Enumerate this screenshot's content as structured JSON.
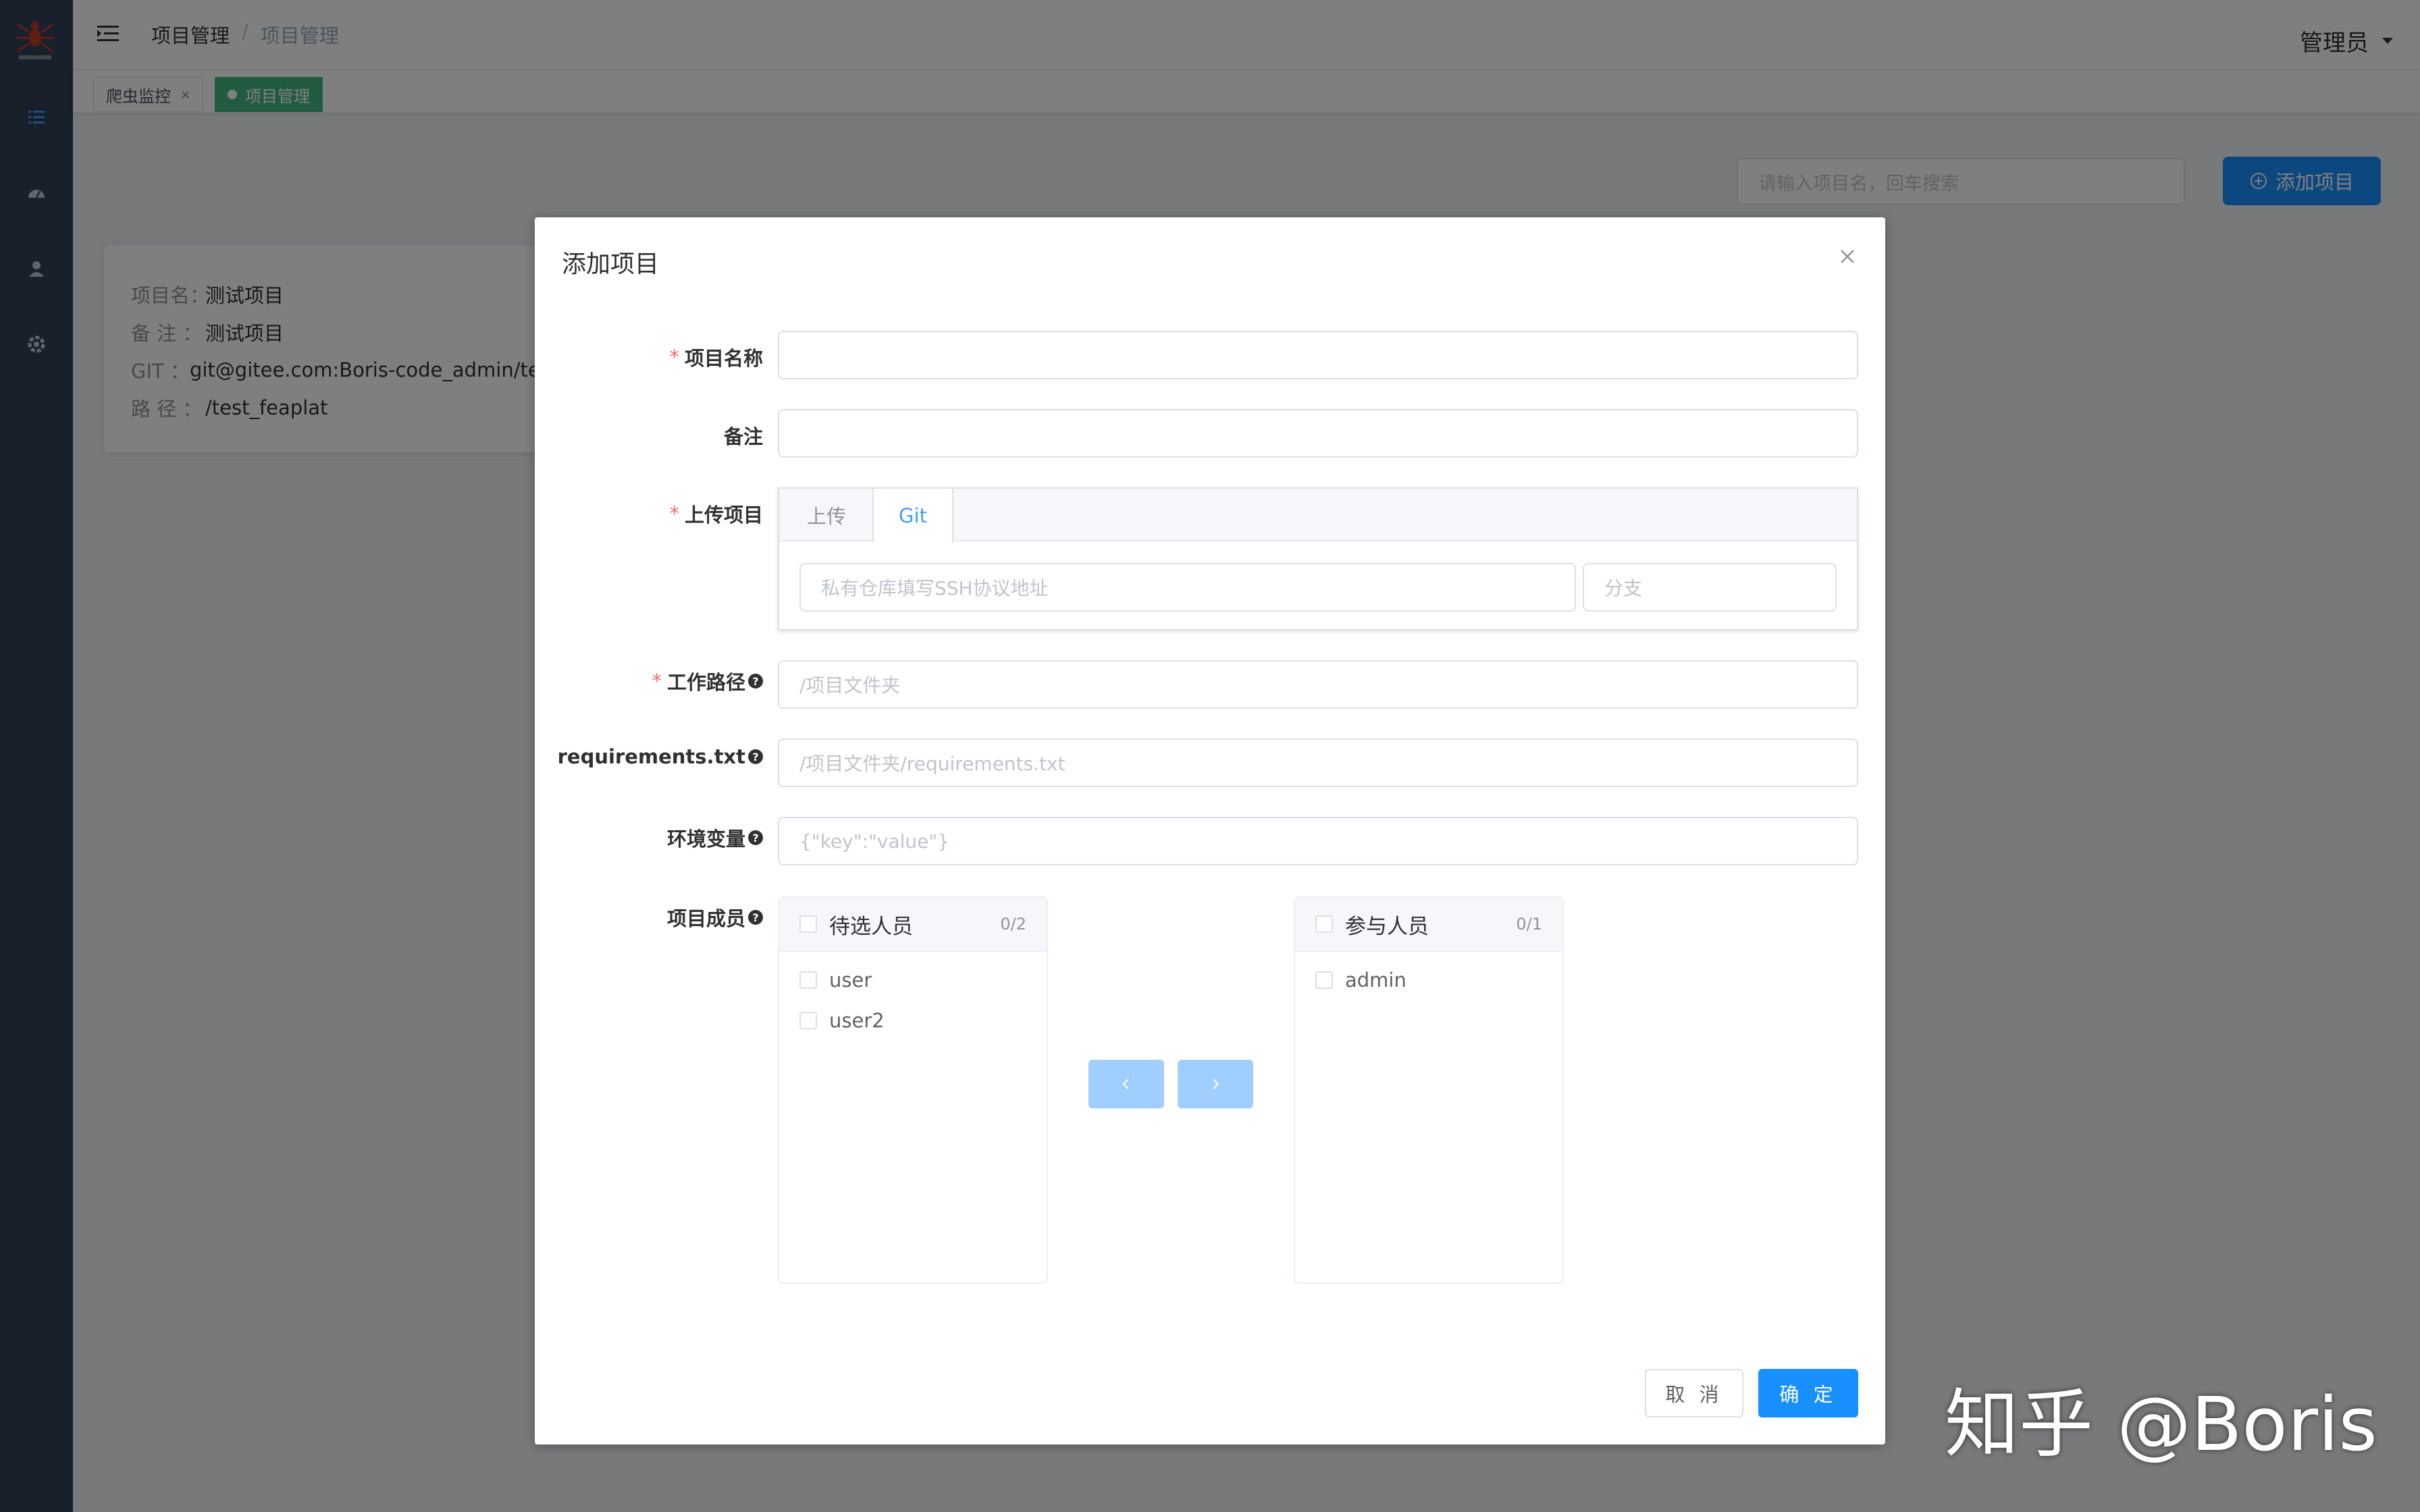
{
  "app": {
    "logo_name": "spider-logo"
  },
  "sidebar": {
    "items": [
      {
        "icon": "list-icon"
      },
      {
        "icon": "dashboard-icon"
      },
      {
        "icon": "user-icon"
      },
      {
        "icon": "settings-icon"
      }
    ]
  },
  "header": {
    "breadcrumb": [
      "项目管理",
      "/",
      "项目管理"
    ],
    "user": "管理员"
  },
  "tags": [
    {
      "label": "爬虫监控",
      "close": "×"
    },
    {
      "label": "项目管理"
    }
  ],
  "page": {
    "search_placeholder": "请输入项目名，回车搜索",
    "add_button": "添加项目",
    "card": {
      "rows": [
        {
          "label": "项目名：",
          "value": "测试项目"
        },
        {
          "label": "备  注 ：",
          "value": "测试项目"
        },
        {
          "label": "GIT     ：",
          "value": "git@gitee.com:Boris-code_admin/test"
        },
        {
          "label": "路  径 ：",
          "value": "/test_feaplat"
        }
      ]
    }
  },
  "dialog": {
    "title": "添加项目",
    "fields": {
      "name_label": "项目名称",
      "note_label": "备注",
      "upload_label": "上传项目",
      "workpath_label": "工作路径",
      "workpath_placeholder": "/项目文件夹",
      "req_label": "requirements.txt",
      "req_placeholder": "/项目文件夹/requirements.txt",
      "env_label": "环境变量",
      "env_placeholder": "{\"key\":\"value\"}",
      "members_label": "项目成员"
    },
    "tabs": {
      "upload": "上传",
      "git": "Git"
    },
    "git_url_placeholder": "私有仓库填写SSH协议地址",
    "branch_placeholder": "分支",
    "transfer": {
      "left_title": "待选人员",
      "left_count": "0/2",
      "left_items": [
        "user",
        "user2"
      ],
      "right_title": "参与人员",
      "right_count": "0/1",
      "right_items": [
        "admin"
      ]
    },
    "cancel": "取 消",
    "ok": "确 定"
  },
  "watermark": "知乎 @Boris",
  "colors": {
    "primary": "#1890ff",
    "sidebar": "#304156",
    "tag_active": "#42b983",
    "required": "#f56c6c"
  }
}
